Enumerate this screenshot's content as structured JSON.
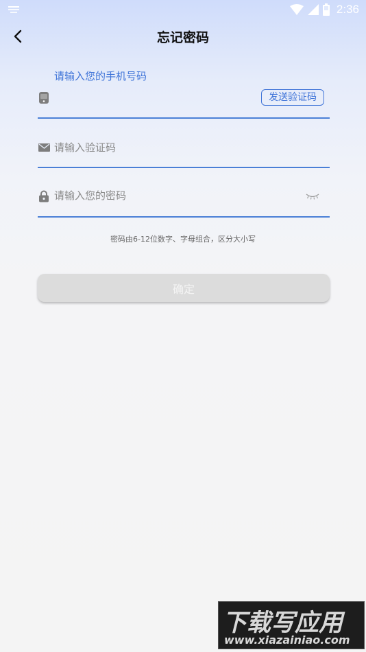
{
  "status_bar": {
    "time": "2:36",
    "icons": [
      "notification-icon",
      "wifi-icon",
      "signal-icon",
      "battery-icon"
    ]
  },
  "header": {
    "title": "忘记密码",
    "back_icon": "chevron-left-icon"
  },
  "form": {
    "phone": {
      "label": "请输入您的手机号码",
      "icon": "phone-icon",
      "send_code_label": "发送验证码"
    },
    "code": {
      "placeholder": "请输入验证码",
      "icon": "mail-icon"
    },
    "password": {
      "placeholder": "请输入您的密码",
      "icon": "lock-icon",
      "toggle_icon": "eye-closed-icon"
    },
    "hint": "密码由6-12位数字、字母组合，区分大小写",
    "confirm_label": "确定"
  },
  "watermark": {
    "line1": "下载写应用",
    "line2": "www.xiazainiao.com"
  },
  "colors": {
    "accent": "#3f74d8",
    "underline": "#4a7fd6",
    "button_disabled": "#dcdcdc"
  }
}
